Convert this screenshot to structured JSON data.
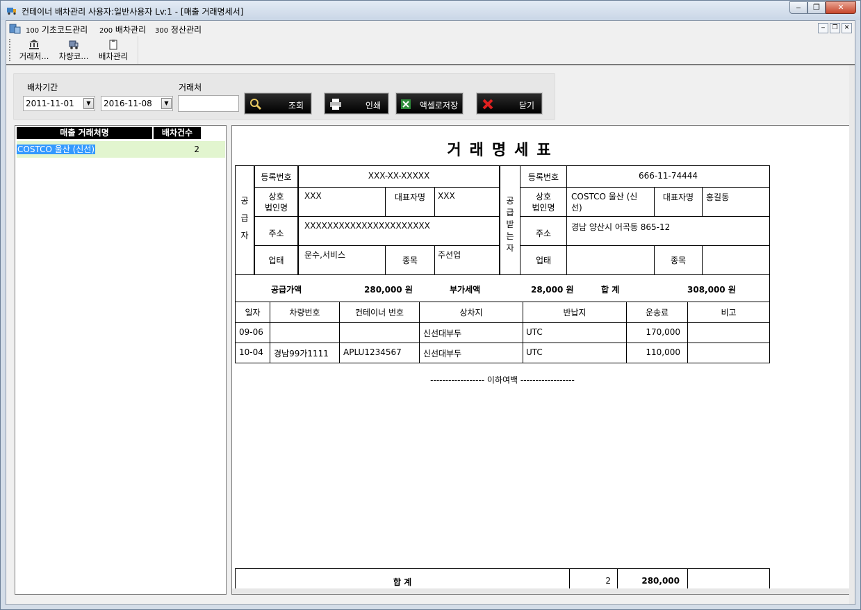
{
  "window": {
    "title": "컨테이너 배차관리  사용자:일반사용자 Lv:1 - [매출 거래명세서]",
    "min_glyph": "‒",
    "max_glyph": "❐",
    "close_glyph": "✕"
  },
  "menu": {
    "items": [
      {
        "code": "100",
        "label": "기초코드관리"
      },
      {
        "code": "200",
        "label": "배차관리"
      },
      {
        "code": "300",
        "label": "정산관리"
      }
    ]
  },
  "toolbar": {
    "items": [
      "거래처...",
      "차량코...",
      "배차관리"
    ]
  },
  "search": {
    "period_label": "배차기간",
    "date_from": "2011-11-01",
    "date_to": "2016-11-08",
    "client_label": "거래처",
    "client_value": "",
    "query_btn": "조회",
    "print_btn": "인쇄",
    "excel_btn": "액셀로저장",
    "close_btn": "닫기"
  },
  "left_grid": {
    "headers": [
      "매출 거래처명",
      "배차건수"
    ],
    "rows": [
      {
        "name": "COSTCO 울산 (신선)",
        "count": "2"
      }
    ]
  },
  "report": {
    "title": "거래명세표",
    "supplier": {
      "side_label": [
        "공",
        "급",
        "자"
      ],
      "reg_no_label": "등록번호",
      "reg_no": "XXX-XX-XXXXX",
      "company_label": [
        "상호",
        "법인명"
      ],
      "company": "XXX",
      "ceo_label": "대표자명",
      "ceo": "XXX",
      "address_label": "주소",
      "address": "XXXXXXXXXXXXXXXXXXXXXX",
      "biz_type_label": "업태",
      "biz_type": "운수,서비스",
      "biz_item_label": "종목",
      "biz_item": "주선업"
    },
    "receiver": {
      "side_label": [
        "공",
        "급",
        "받",
        "는",
        "자"
      ],
      "reg_no_label": "등록번호",
      "reg_no": "666-11-74444",
      "company_label": [
        "상호",
        "법인명"
      ],
      "company": [
        "COSTCO 울산 (신",
        "선)"
      ],
      "ceo_label": "대표자명",
      "ceo": "홍길동",
      "address_label": "주소",
      "address": "경남 양산시 어곡동 865-12",
      "biz_type_label": "업태",
      "biz_type": "",
      "biz_item_label": "종목",
      "biz_item": ""
    },
    "summary": {
      "supply_label": "공급가액",
      "supply_value": "280,000  원",
      "vat_label": "부가세액",
      "vat_value": "28,000  원",
      "total_label": "합    계",
      "total_value": "308,000  원"
    },
    "detail_headers": [
      "일자",
      "차량번호",
      "컨테이너 번호",
      "상차지",
      "반납지",
      "운송료",
      "비고"
    ],
    "detail_rows": [
      {
        "date": "09-06",
        "vehicle": "",
        "container": "",
        "load": "신선대부두",
        "return": "UTC",
        "fee": "170,000",
        "note": ""
      },
      {
        "date": "10-04",
        "vehicle": "경남99가1111",
        "container": "APLU1234567",
        "load": "신선대부두",
        "return": "UTC",
        "fee": "110,000",
        "note": ""
      }
    ],
    "blank_marker": "------------------ 이하여백 ------------------",
    "footer": {
      "label": "합          계",
      "count": "2",
      "amount": "280,000"
    }
  }
}
